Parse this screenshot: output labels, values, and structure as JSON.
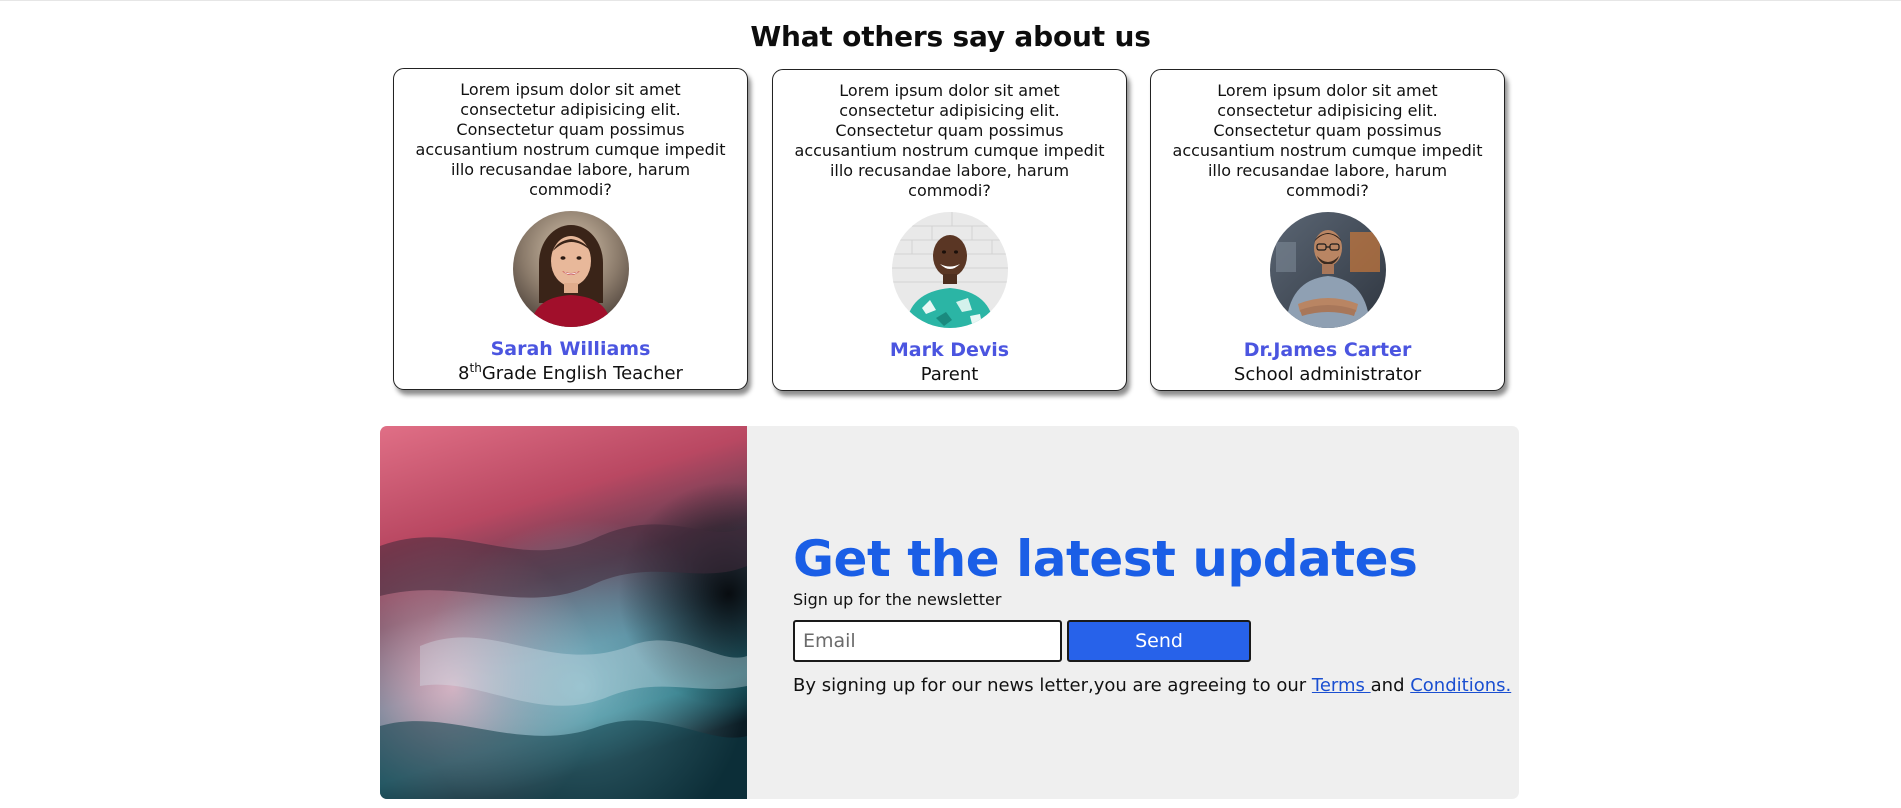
{
  "testimonials": {
    "title": "What others say about us",
    "cards": [
      {
        "quote": "Lorem ipsum dolor sit amet consectetur adipisicing elit. Consectetur quam possimus accusantium nostrum cumque impedit illo recusandae labore, harum commodi?",
        "name": "Sarah Williams",
        "role_prefix": "8",
        "role_sup": "th",
        "role_suffix": "Grade English Teacher"
      },
      {
        "quote": "Lorem ipsum dolor sit amet consectetur adipisicing elit. Consectetur quam possimus accusantium nostrum cumque impedit illo recusandae labore, harum commodi?",
        "name": "Mark Devis",
        "role": "Parent"
      },
      {
        "quote": "Lorem ipsum dolor sit amet consectetur adipisicing elit. Consectetur quam possimus accusantium nostrum cumque impedit illo recusandae labore, harum commodi?",
        "name": "Dr.James Carter",
        "role": "School administrator"
      }
    ]
  },
  "newsletter": {
    "title": "Get the latest updates",
    "subtitle": "Sign up for the newsletter",
    "email_placeholder": "Email",
    "send_label": "Send",
    "agree_text": "By signing up for our news letter,you are agreeing to our ",
    "terms_label": "Terms ",
    "and_text": "and ",
    "conditions_label": "Conditions."
  },
  "colors": {
    "name_accent": "#4b55e0",
    "headline_blue": "#1a5ee6",
    "button_blue": "#2762ea",
    "panel_bg": "#efefef"
  }
}
